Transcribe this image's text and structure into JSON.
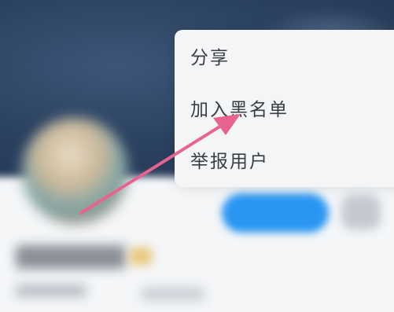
{
  "menu": {
    "items": [
      {
        "label": "分享"
      },
      {
        "label": "加入黑名单"
      },
      {
        "label": "举报用户"
      }
    ]
  },
  "colors": {
    "arrow": "#e8638f",
    "follow_button": "#2a96f2",
    "menu_background": "#f4f5f7",
    "menu_text": "#3a3d42"
  }
}
